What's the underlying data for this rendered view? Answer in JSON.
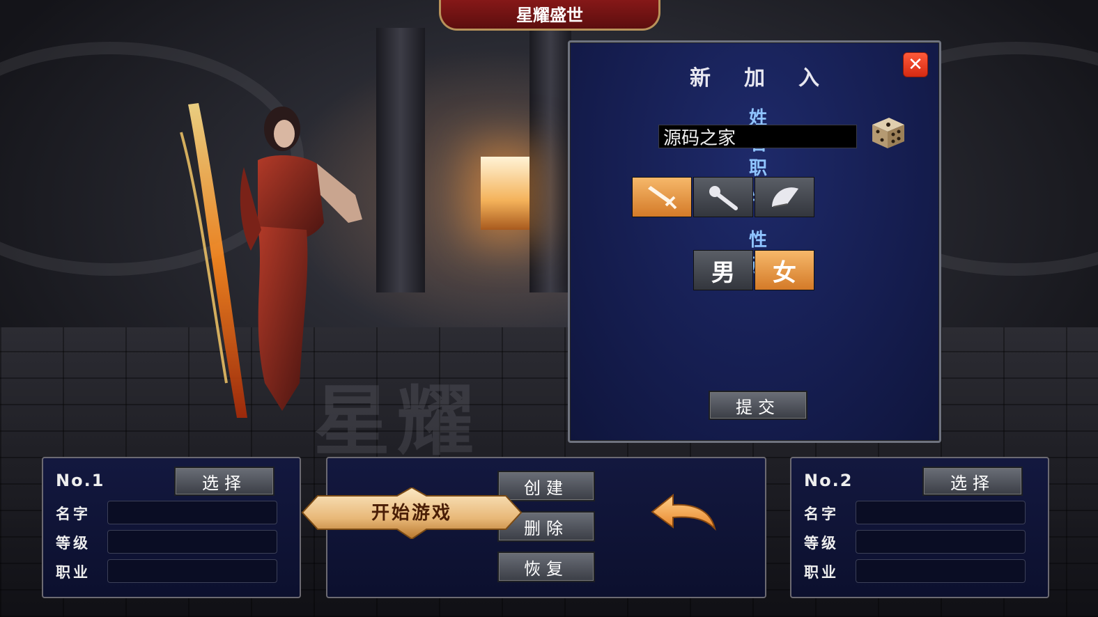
{
  "game_title": "星耀盛世",
  "dialog": {
    "title": "新加入",
    "close_icon": "close-icon",
    "name_label": "姓名",
    "name_value": "源码之家",
    "job_label": "职业",
    "jobs": [
      {
        "icon": "sword-icon",
        "selected": true
      },
      {
        "icon": "staff-icon",
        "selected": false
      },
      {
        "icon": "fan-icon",
        "selected": false
      }
    ],
    "gender_label": "性别",
    "genders": [
      {
        "label": "男",
        "selected": false
      },
      {
        "label": "女",
        "selected": true
      }
    ],
    "submit_label": "提交"
  },
  "slots": [
    {
      "no": "No.1",
      "select_label": "选择",
      "name_label": "名字",
      "level_label": "等级",
      "job_label": "职业",
      "name": "",
      "level": "",
      "job": ""
    },
    {
      "no": "No.2",
      "select_label": "选择",
      "name_label": "名字",
      "level_label": "等级",
      "job_label": "职业",
      "name": "",
      "level": "",
      "job": ""
    }
  ],
  "center": {
    "start_label": "开始游戏",
    "create_label": "创建",
    "delete_label": "删除",
    "restore_label": "恢复",
    "back_icon": "back-arrow-icon"
  },
  "colors": {
    "accent_orange": "#e8963f",
    "dialog_bg": "#151d4f",
    "banner_red": "#8e1a1a"
  }
}
